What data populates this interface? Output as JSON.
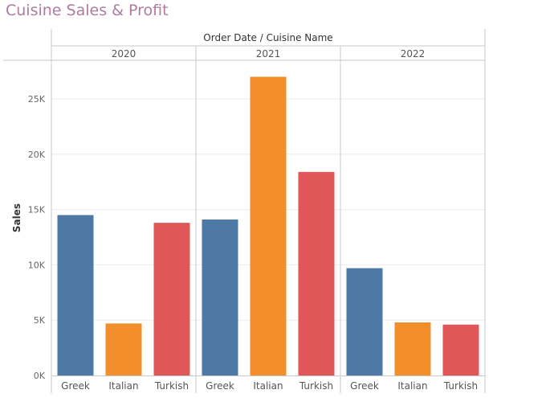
{
  "title": "Cuisine Sales & Profit",
  "chart_data": {
    "type": "bar",
    "title": "Cuisine Sales & Profit",
    "header_label": "Order Date  /  Cuisine Name",
    "ylabel": "Sales",
    "xlabel": "",
    "ylim": [
      0,
      27500
    ],
    "yticks": [
      0,
      5000,
      10000,
      15000,
      20000,
      25000
    ],
    "ytick_labels": [
      "0K",
      "5K",
      "10K",
      "15K",
      "20K",
      "25K"
    ],
    "grid": true,
    "groups": [
      {
        "name": "2020",
        "bars": [
          {
            "category": "Greek",
            "value": 14500
          },
          {
            "category": "Italian",
            "value": 4700
          },
          {
            "category": "Turkish",
            "value": 13800
          }
        ]
      },
      {
        "name": "2021",
        "bars": [
          {
            "category": "Greek",
            "value": 14100
          },
          {
            "category": "Italian",
            "value": 27000
          },
          {
            "category": "Turkish",
            "value": 18400
          }
        ]
      },
      {
        "name": "2022",
        "bars": [
          {
            "category": "Greek",
            "value": 9700
          },
          {
            "category": "Italian",
            "value": 4800
          },
          {
            "category": "Turkish",
            "value": 4600
          }
        ]
      }
    ],
    "colors": {
      "Greek": "#4e79a7",
      "Italian": "#f28e2b",
      "Turkish": "#e15759"
    }
  }
}
